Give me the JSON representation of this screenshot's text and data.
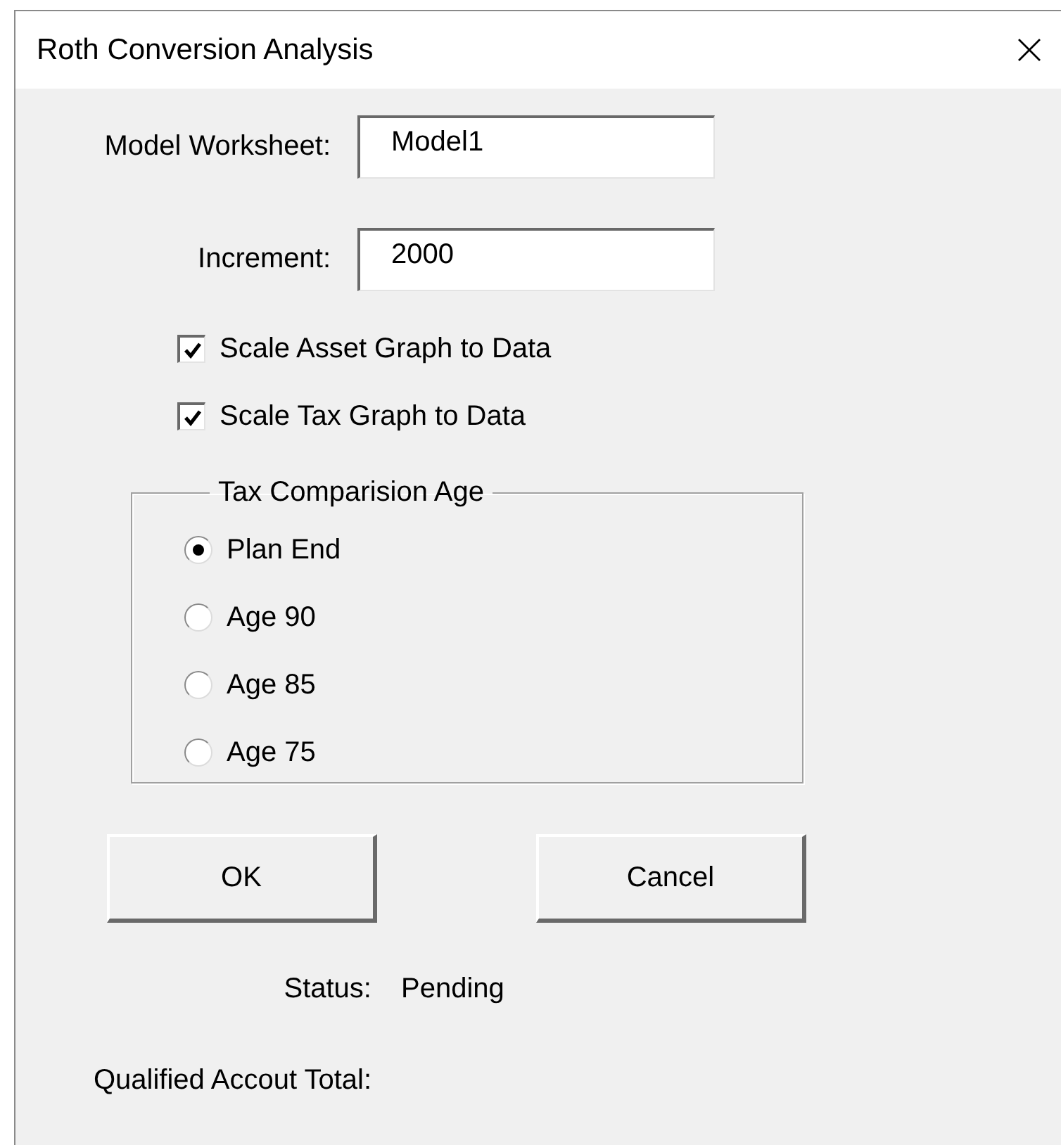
{
  "window": {
    "title": "Roth Conversion Analysis"
  },
  "fields": [
    {
      "label": "Model Worksheet:",
      "value": "Model1"
    },
    {
      "label": "Increment:",
      "value": "2000"
    }
  ],
  "checkboxes": [
    {
      "label": "Scale Asset Graph to Data",
      "checked": true
    },
    {
      "label": "Scale Tax Graph to Data",
      "checked": true
    }
  ],
  "group": {
    "title": "Tax Comparision Age",
    "options": [
      {
        "label": "Plan End",
        "selected": true
      },
      {
        "label": "Age 90",
        "selected": false
      },
      {
        "label": "Age 85",
        "selected": false
      },
      {
        "label": "Age 75",
        "selected": false
      }
    ]
  },
  "buttons": [
    "OK",
    "Cancel"
  ],
  "status": {
    "label": "Status:",
    "value": "Pending"
  },
  "total": {
    "label": "Qualified Accout Total:"
  }
}
